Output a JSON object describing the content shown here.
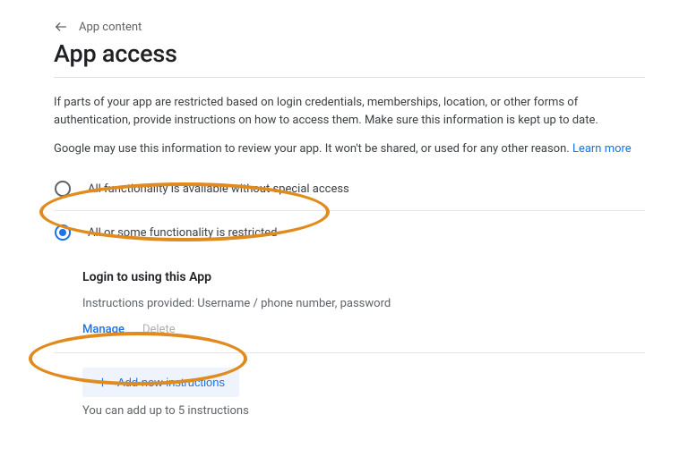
{
  "breadcrumb": {
    "label": "App content"
  },
  "page_title": "App access",
  "intro1": "If parts of your app are restricted based on login credentials, memberships, location, or other forms of authentication, provide instructions on how to access them. Make sure this information is kept up to date.",
  "intro2": "Google may use this information to review your app. It won't be shared, or used for any other reason. ",
  "learn_more": "Learn more",
  "options": {
    "opt1_label": "All functionality is available without special access",
    "opt2_label": "All or some functionality is restricted"
  },
  "instruction": {
    "title": "Login to using this App",
    "summary": "Instructions provided: Username / phone number, password",
    "manage": "Manage",
    "delete": "Delete"
  },
  "add_button": "Add new instructions",
  "limit_text": "You can add up to 5 instructions"
}
